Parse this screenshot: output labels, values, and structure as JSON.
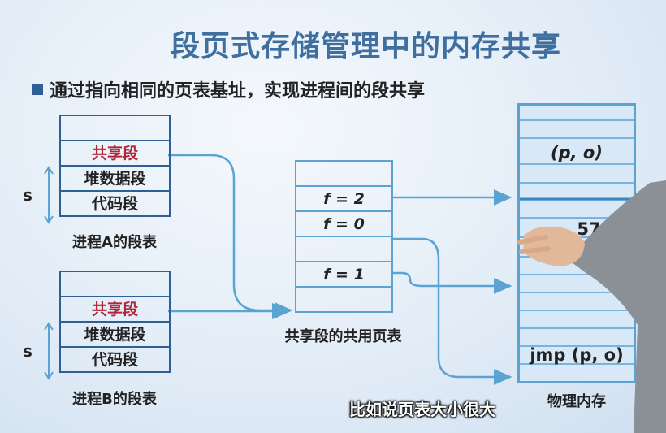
{
  "title": "段页式存储管理中的内存共享",
  "subtitle": "通过指向相同的页表基址，实现进程间的段共享",
  "process_a": {
    "caption": "进程A的段表",
    "rows": [
      "",
      "共享段",
      "堆数据段",
      "代码段"
    ],
    "s_label": "s"
  },
  "process_b": {
    "caption": "进程B的段表",
    "rows": [
      "",
      "共享段",
      "堆数据段",
      "代码段"
    ],
    "s_label": "s"
  },
  "shared_page_table": {
    "caption": "共享段的共用页表",
    "rows": [
      "",
      "f = 2",
      "f = 0",
      "",
      "f = 1",
      ""
    ]
  },
  "physical_memory": {
    "caption": "物理内存",
    "labels": {
      "po_top": "(p, o)",
      "num": "57",
      "jmp": "jmp (p, o)"
    }
  },
  "video_subtitle": "比如说页表大小很大",
  "colors": {
    "title": "#3f6f9e",
    "table_border": "#2f5f95",
    "shared_segment_text": "#b3243b",
    "arrow": "#5aa3d3",
    "memory_border": "#5aa3d3"
  }
}
